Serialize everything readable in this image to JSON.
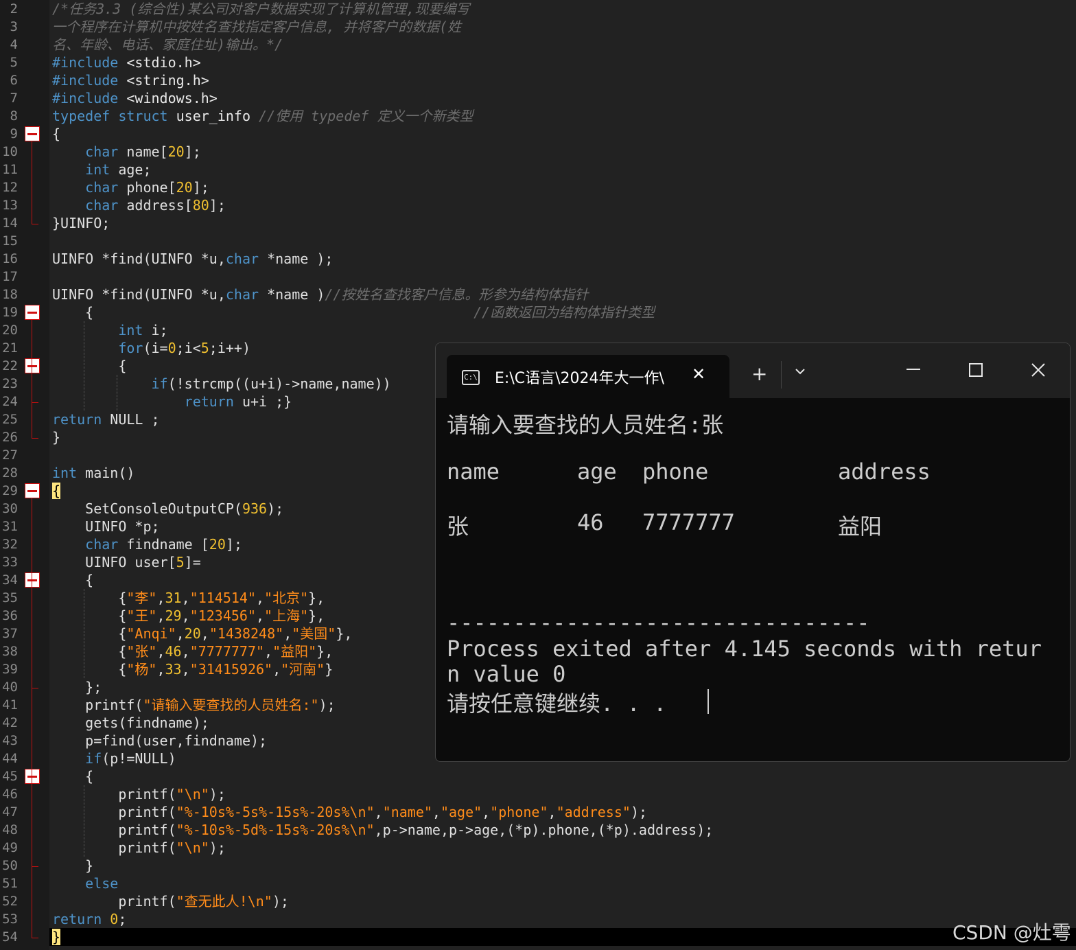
{
  "gutter": {
    "line_numbers": [
      "2",
      "3",
      "4",
      "5",
      "6",
      "7",
      "8",
      "9",
      "10",
      "11",
      "12",
      "13",
      "14",
      "15",
      "16",
      "17",
      "18",
      "19",
      "20",
      "21",
      "22",
      "23",
      "24",
      "25",
      "26",
      "27",
      "28",
      "29",
      "30",
      "31",
      "32",
      "33",
      "34",
      "35",
      "36",
      "37",
      "38",
      "39",
      "40",
      "41",
      "42",
      "43",
      "44",
      "45",
      "46",
      "47",
      "48",
      "49",
      "50",
      "51",
      "52",
      "53",
      "54"
    ]
  },
  "code": {
    "l2": "/*任务3.3 (综合性)某公司对客户数据实现了计算机管理,现要编写",
    "l3": "一个程序在计算机中按姓名查找指定客户信息, 并将客户的数据(姓",
    "l4": "名、年龄、电话、家庭住址)输出。*/",
    "l5a": "#include ",
    "l5b": "<stdio.h>",
    "l6a": "#include ",
    "l6b": "<string.h>",
    "l7a": "#include ",
    "l7b": "<windows.h>",
    "l8a": "typedef struct ",
    "l8b": "user_info ",
    "l8c": "//使用 typedef 定义一个新类型",
    "l9": "{",
    "l10a": "    char ",
    "l10b": "name[",
    "l10c": "20",
    "l10d": "];",
    "l11a": "    int ",
    "l11b": "age;",
    "l12a": "    char ",
    "l12b": "phone[",
    "l12c": "20",
    "l12d": "];",
    "l13a": "    char ",
    "l13b": "address[",
    "l13c": "80",
    "l13d": "];",
    "l14": "}UINFO;",
    "l16a": "UINFO *find(UINFO *u,",
    "l16b": "char",
    "l16c": " *name );",
    "l18a": "UINFO *find(UINFO *u,",
    "l18b": "char",
    "l18c": " *name )",
    "l18d": "//按姓名查找客户信息。形参为结构体指针",
    "l19a": "    {",
    "l19b": "                                              //函数返回为结构体指针类型",
    "l20a": "        int ",
    "l20b": "i;",
    "l21a": "        for",
    "l21b": "(i=",
    "l21c": "0",
    "l21d": ";i<",
    "l21e": "5",
    "l21f": ";i++)",
    "l22": "        {",
    "l23a": "            if",
    "l23b": "(!strcmp((u+i)->name,name))",
    "l24a": "                return ",
    "l24b": "u+i ;}",
    "l25a": "return ",
    "l25b": "NULL ;",
    "l26": "}",
    "l28a": "int ",
    "l28b": "main()",
    "l29": "{",
    "l30a": "    SetConsoleOutputCP(",
    "l30b": "936",
    "l30c": ");",
    "l31": "    UINFO *p;",
    "l32a": "    char ",
    "l32b": "findname [",
    "l32c": "20",
    "l32d": "];",
    "l33a": "    UINFO user[",
    "l33b": "5",
    "l33c": "]=",
    "l34": "    {",
    "l35a": "        {",
    "l35b": "\"李\"",
    "l35c": ",",
    "l35d": "31",
    "l35e": ",",
    "l35f": "\"114514\"",
    "l35g": ",",
    "l35h": "\"北京\"",
    "l35i": "},",
    "l36a": "        {",
    "l36b": "\"王\"",
    "l36c": ",",
    "l36d": "29",
    "l36e": ",",
    "l36f": "\"123456\"",
    "l36g": ",",
    "l36h": "\"上海\"",
    "l36i": "},",
    "l37a": "        {",
    "l37b": "\"Anqi\"",
    "l37c": ",",
    "l37d": "20",
    "l37e": ",",
    "l37f": "\"1438248\"",
    "l37g": ",",
    "l37h": "\"美国\"",
    "l37i": "},",
    "l38a": "        {",
    "l38b": "\"张\"",
    "l38c": ",",
    "l38d": "46",
    "l38e": ",",
    "l38f": "\"7777777\"",
    "l38g": ",",
    "l38h": "\"益阳\"",
    "l38i": "},",
    "l39a": "        {",
    "l39b": "\"杨\"",
    "l39c": ",",
    "l39d": "33",
    "l39e": ",",
    "l39f": "\"31415926\"",
    "l39g": ",",
    "l39h": "\"河南\"",
    "l39i": "}",
    "l40": "    };",
    "l41a": "    printf(",
    "l41b": "\"请输入要查找的人员姓名:\"",
    "l41c": ");",
    "l42": "    gets(findname);",
    "l43": "    p=find(user,findname);",
    "l44a": "    if",
    "l44b": "(p!=NULL)",
    "l45": "    {",
    "l46a": "        printf(",
    "l46b": "\"\\n\"",
    "l46c": ");",
    "l47a": "        printf(",
    "l47b": "\"%-10s%-5s%-15s%-20s%\\n\"",
    "l47c": ",",
    "l47d": "\"name\"",
    "l47e": ",",
    "l47f": "\"age\"",
    "l47g": ",",
    "l47h": "\"phone\"",
    "l47i": ",",
    "l47j": "\"address\"",
    "l47k": ");",
    "l48a": "        printf(",
    "l48b": "\"%-10s%-5d%-15s%-20s%\\n\"",
    "l48c": ",p->name,p->age,(*p).phone,(*p).address);",
    "l49a": "        printf(",
    "l49b": "\"\\n\"",
    "l49c": ");",
    "l50": "    }",
    "l51": "    else",
    "l52a": "        printf(",
    "l52b": "\"查无此人!\\n\"",
    "l52c": ");",
    "l53a": "return ",
    "l53b": "0",
    "l53c": ";",
    "l54": "}"
  },
  "terminal": {
    "tab_title": "E:\\C语言\\2024年大一作\\",
    "icon": "terminal-icon",
    "new_tab": "+",
    "dropdown": "chevron-down-icon",
    "minimize": "—",
    "close": "✕",
    "prompt_line": "请输入要查找的人员姓名:张",
    "header_name": "name",
    "header_age": "age",
    "header_phone": "phone",
    "header_address": "address",
    "row_name": "张",
    "row_age": "46",
    "row_phone": "7777777",
    "row_address": "益阳",
    "separator": "--------------------------------",
    "exit_line1": "Process exited after 4.145 seconds with retur",
    "exit_line2": "n value 0",
    "continue_line": "请按任意键继续. . ."
  },
  "watermark": "CSDN @灶雩",
  "colors": {
    "keyword": "#4e93c9",
    "number": "#f0c030",
    "string": "#ff8c1a",
    "comment": "#6d6d6d",
    "fold_marker": "#d01010"
  }
}
